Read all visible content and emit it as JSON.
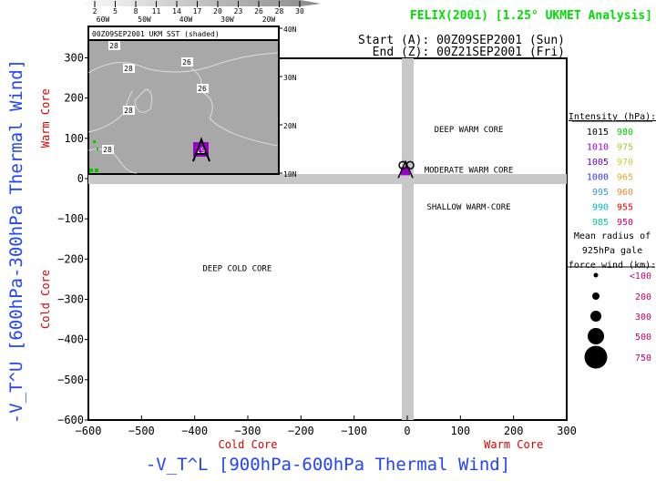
{
  "header": {
    "title": "FELIX(2001) [1.25° UKMET Analysis]",
    "title_color": "#00dd00",
    "start_label": "Start (A): 00Z09SEP2001 (Sun)",
    "end_label": "End (Z): 00Z21SEP2001 (Fri)"
  },
  "colorbar": {
    "ticks": [
      "2",
      "5",
      "8",
      "11",
      "14",
      "17",
      "20",
      "23",
      "26",
      "28",
      "30"
    ]
  },
  "inset_map": {
    "title": "00Z09SEP2001 UKM SST (shaded)",
    "lon_labels": [
      "60W",
      "50W",
      "40W",
      "30W",
      "20W"
    ],
    "lat_labels": [
      "40N",
      "30N",
      "20N",
      "10N"
    ],
    "contour_labels": [
      "28",
      "26",
      "28",
      "26",
      "28",
      "28"
    ],
    "storm_marker_label": "A",
    "storm_marker_number": "19"
  },
  "legend": {
    "intensity_title": "Intensity (hPa):",
    "intensity_rows": [
      {
        "left": "1015",
        "left_color": "#000000",
        "right": "980",
        "right_color": "#00cc00"
      },
      {
        "left": "1010",
        "left_color": "#9900cc",
        "right": "975",
        "right_color": "#99cc33"
      },
      {
        "left": "1005",
        "left_color": "#6600cc",
        "right": "970",
        "right_color": "#cccc33"
      },
      {
        "left": "1000",
        "left_color": "#3333ff",
        "right": "965",
        "right_color": "#ddaa33"
      },
      {
        "left": "995",
        "left_color": "#3399cc",
        "right": "960",
        "right_color": "#ee8833"
      },
      {
        "left": "990",
        "left_color": "#00bbbb",
        "right": "955",
        "right_color": "#ee0000"
      },
      {
        "left": "985",
        "left_color": "#00cc99",
        "right": "950",
        "right_color": "#cc0066"
      }
    ],
    "radius_title_lines": [
      "Mean radius of",
      "925hPa gale",
      "force wind (km):"
    ],
    "radius_rows": [
      {
        "label": "<100"
      },
      {
        "label": "200"
      },
      {
        "label": "300"
      },
      {
        "label": "500"
      },
      {
        "label": "750"
      }
    ],
    "radius_label_color": "#cc0066"
  },
  "chart_data": {
    "type": "scatter",
    "title": "FELIX(2001) [1.25° UKMET Analysis]",
    "xlabel": "-V_T^L [900hPa-600hPa Thermal Wind]",
    "ylabel": "-V_T^U [600hPa-300hPa Thermal Wind]",
    "xlim": [
      -600,
      300
    ],
    "ylim": [
      -600,
      350
    ],
    "xticks": [
      -600,
      -500,
      -400,
      -300,
      -200,
      -100,
      0,
      100,
      200,
      300
    ],
    "yticks": [
      -600,
      -500,
      -400,
      -300,
      -200,
      -100,
      0,
      100,
      200,
      300
    ],
    "xtick_labels": [
      "−600",
      "−500",
      "−400",
      "−300",
      "−200",
      "−100",
      "0",
      "100",
      "200",
      "300"
    ],
    "ytick_labels": [
      "−600",
      "−500",
      "−400",
      "−300",
      "−200",
      "−100",
      "0",
      "100",
      "200",
      "300"
    ],
    "x_annotations": [
      {
        "text": "Cold Core",
        "x": -300,
        "color": "#dd0000"
      },
      {
        "text": "Warm Core",
        "x": 200,
        "color": "#dd0000"
      }
    ],
    "y_annotations": [
      {
        "text": "Warm Core",
        "y": 150,
        "color": "#dd0000"
      },
      {
        "text": "Cold Core",
        "y": -300,
        "color": "#dd0000"
      }
    ],
    "region_labels": [
      {
        "text": "DEEP WARM CORE",
        "x": 150,
        "y": 115
      },
      {
        "text": "MODERATE WARM CORE",
        "x": 150,
        "y": 15
      },
      {
        "text": "SHALLOW WARM-CORE",
        "x": 150,
        "y": -77
      },
      {
        "text": "DEEP COLD CORE",
        "x": -320,
        "y": -230
      }
    ],
    "track": [
      {
        "label": "A",
        "x": -5,
        "y": 15,
        "intensity_color": "#9900cc"
      },
      {
        "label": "Z",
        "x": 5,
        "y": 20,
        "intensity_color": "#9900cc"
      }
    ],
    "grid": false,
    "legend_position": "right"
  }
}
